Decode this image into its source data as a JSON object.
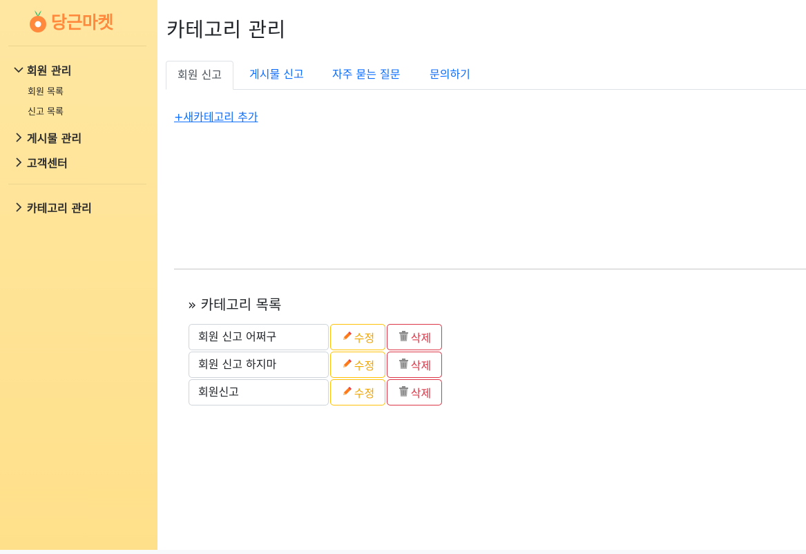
{
  "brand": {
    "name": "당근마켓"
  },
  "sidebar": {
    "groups": [
      {
        "label": "회원 관리",
        "expanded": true,
        "icon": "chevron-down-icon",
        "items": [
          {
            "label": "회원 목록"
          },
          {
            "label": "신고 목록"
          }
        ]
      },
      {
        "label": "게시물 관리",
        "expanded": false,
        "icon": "chevron-right-icon"
      },
      {
        "label": "고객센터",
        "expanded": false,
        "icon": "chevron-right-icon"
      },
      {
        "label": "카테고리 관리",
        "expanded": false,
        "icon": "chevron-right-icon"
      }
    ]
  },
  "main": {
    "title": "카테고리 관리",
    "tabs": [
      {
        "label": "회원 신고",
        "active": true
      },
      {
        "label": "게시물 신고",
        "active": false
      },
      {
        "label": "자주 묻는 질문",
        "active": false
      },
      {
        "label": "문의하기",
        "active": false
      }
    ],
    "add_link": "+새카테고리 추가",
    "list_title": "» 카테고리 목록",
    "categories": [
      {
        "name": "회원 신고 어쩌구"
      },
      {
        "name": "회원 신고 하지마"
      },
      {
        "name": "회원신고"
      }
    ],
    "edit_label": "수정",
    "delete_label": "삭제"
  },
  "colors": {
    "sidebar_bg": "#ffe08a",
    "brand_orange": "#ff8a3d",
    "link_blue": "#0d6efd",
    "edit_yellow": "#ffc107",
    "delete_red": "#dc3545"
  },
  "icons": [
    "carrot-logo-icon",
    "chevron-down-icon",
    "chevron-right-icon",
    "pencil-icon",
    "trash-icon"
  ]
}
